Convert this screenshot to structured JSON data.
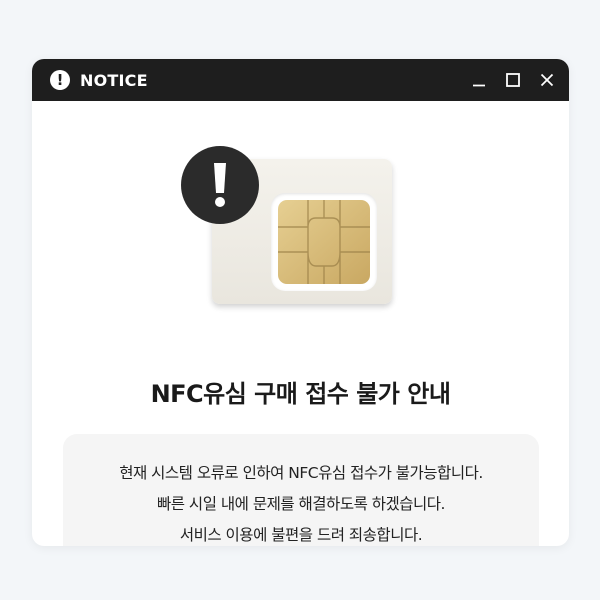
{
  "window": {
    "title": "NOTICE",
    "title_icon": "exclamation-circle-icon",
    "controls": [
      "minimize-icon",
      "maximize-icon",
      "close-icon"
    ]
  },
  "main": {
    "illustration": "sim-card-icon",
    "badge_icon": "exclamation-icon",
    "heading": "NFC유심 구매 접수 불가 안내",
    "message_lines": [
      "현재 시스템 오류로 인하여 NFC유심 접수가 불가능합니다.",
      "빠른 시일 내에 문제를 해결하도록 하겠습니다.",
      "서비스 이용에 불편을 드려 죄송합니다."
    ]
  },
  "colors": {
    "titlebar": "#1e1e1e",
    "page_background": "#f3f6f9",
    "chip_gold": "#d9bf7f",
    "badge": "#2b2b2b",
    "message_box": "#f5f5f5"
  }
}
